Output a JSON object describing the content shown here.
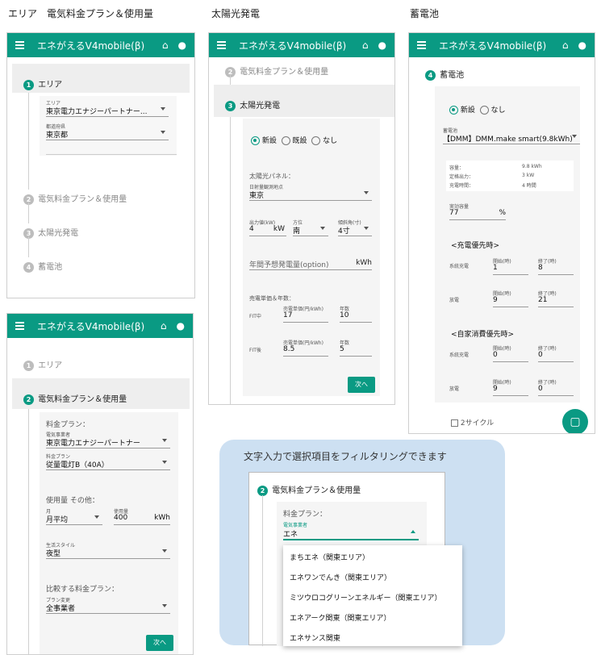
{
  "sections": {
    "area": "エリア　電気料金プラン＆使用量",
    "solar": "太陽光発電",
    "battery": "蓄電池"
  },
  "app": {
    "title": "エネがえるV4mobile(β)"
  },
  "steps": {
    "s1": "エリア",
    "s2": "電気料金プラン＆使用量",
    "s3": "太陽光発電",
    "s4": "蓄電池"
  },
  "n": {
    "one": "1",
    "two": "2",
    "three": "3",
    "four": "4"
  },
  "p1": {
    "area_label": "エリア",
    "area_value": "東京電力エナジーパートナー...",
    "pref_label": "都道府県",
    "pref_value": "東京都"
  },
  "p2": {
    "plan_heading": "料金プラン：",
    "provider_label": "電気事業者",
    "provider_value": "東京電力エナジーパートナー",
    "plan_label": "料金プラン",
    "plan_value": "従量電灯B（40A）",
    "usage_heading": "使用量 その他：",
    "month_label": "月",
    "month_value": "月平均",
    "usage_label": "使用量",
    "usage_value": "400",
    "usage_unit": "kWh",
    "life_label": "生活スタイル",
    "life_value": "夜型",
    "compare_heading": "比較する料金プラン：",
    "change_label": "プラン変更",
    "change_value": "全事業者",
    "next": "次へ"
  },
  "p3": {
    "new": "新設",
    "existing": "既設",
    "none": "なし",
    "panel_heading": "太陽光パネル：",
    "site_label": "日射量観測地点",
    "site_value": "東京",
    "output_label": "出力値(kW)",
    "output_value": "4",
    "output_unit": "kW",
    "dir_label": "方位",
    "dir_value": "南",
    "tilt_label": "傾斜角(寸)",
    "tilt_value": "4寸",
    "annual_placeholder": "年間予想発電量(option)",
    "annual_unit": "kWh",
    "sell_heading": "売電単価＆年数：",
    "fit_in": "FIT中",
    "fit_after": "FIT後",
    "price_label": "売電単価(円/kWh)",
    "years_label": "年数",
    "fit_in_price": "17",
    "fit_in_years": "10",
    "fit_after_price": "8.5",
    "fit_after_years": "5",
    "next": "次へ"
  },
  "p4": {
    "new": "新設",
    "none": "なし",
    "battery_label": "蓄電池",
    "battery_value": "【DMM】DMM.make smart(9.8kWh)",
    "capacity_label": "容量：",
    "capacity_value": "9.8 kWh",
    "rated_label": "定格出力：",
    "rated_value": "3 kW",
    "charge_label": "充電時間：",
    "charge_value": "4 時間",
    "effective_label": "実効容量",
    "effective_value": "77",
    "effective_unit": "%",
    "charge_priority": "<充電優先時>",
    "self_priority": "<自家消費優先時>",
    "grid_charge": "系統充電",
    "discharge": "放電",
    "start_label": "開始(時)",
    "end_label": "終了(時)",
    "cp_grid_start": "1",
    "cp_grid_end": "8",
    "cp_dis_start": "9",
    "cp_dis_end": "21",
    "sp_grid_start": "0",
    "sp_grid_end": "0",
    "sp_dis_start": "9",
    "sp_dis_end": "0",
    "two_cycle": "2サイクル"
  },
  "callout": {
    "title": "文字入力で選択項目をフィルタリングできます",
    "plan_heading": "料金プラン：",
    "provider_label": "電気事業者",
    "input_value": "エネ",
    "options": [
      "まちエネ（関東エリア）",
      "エネワンでんき（関東エリア）",
      "ミツウロコグリーンエネルギー（関東エリア）",
      "エネアーク関東（関東エリア）",
      "エネサンス関東"
    ]
  }
}
